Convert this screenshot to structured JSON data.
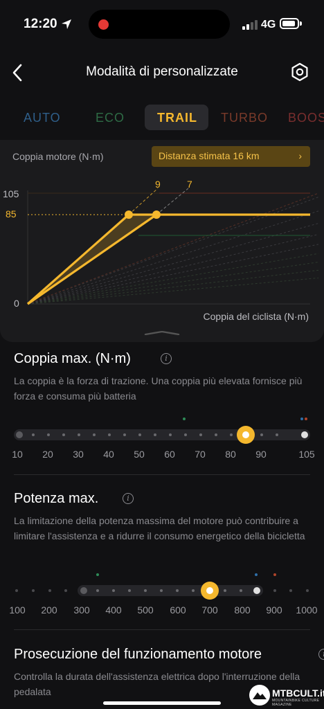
{
  "status_bar": {
    "time": "12:20",
    "network": "4G"
  },
  "header": {
    "title": "Modalità di personalizzate"
  },
  "tabs": [
    {
      "label": "AUTO",
      "color": "#2F5F8A"
    },
    {
      "label": "ECO",
      "color": "#2E6B45"
    },
    {
      "label": "TRAIL",
      "color": "#F5B82E",
      "active": true
    },
    {
      "label": "TURBO",
      "color": "#7A3A2A"
    },
    {
      "label": "BOOS",
      "color": "#7A2E2E"
    }
  ],
  "chart_panel": {
    "torque_label": "Coppia motore (N·m)",
    "distance_button": "Distanza stimata 16 km",
    "chart_data": {
      "type": "line",
      "xlabel": "Coppia del ciclista (N·m)",
      "ylabel": "",
      "y_ticks": [
        "105",
        "85",
        "0"
      ],
      "series": [
        {
          "values": [
            [
              0,
              0
            ],
            [
              9,
              85
            ],
            [
              20,
              85
            ]
          ]
        },
        {
          "values": [
            [
              0,
              0
            ],
            [
              7,
              85
            ],
            [
              20,
              85
            ]
          ]
        }
      ],
      "annotations": [
        "9",
        "7"
      ],
      "max_torque_line": 85,
      "accent_color": "#F5B82E"
    }
  },
  "torque_section": {
    "title": "Coppia max. (N·m)",
    "description": "La coppia è la forza di trazione. Una coppia più elevata fornisce più forza e consuma più batteria",
    "ticks": [
      "10",
      "20",
      "30",
      "40",
      "50",
      "60",
      "70",
      "80",
      "90",
      "105"
    ],
    "value": 85,
    "min": 10,
    "max": 105
  },
  "power_section": {
    "title": "Potenza max.",
    "description": "La limitazione della potenza massima del motore può contribuire a limitare l'assistenza e a ridurre il consumo energetico della bicicletta",
    "ticks": [
      "100",
      "200",
      "300",
      "400",
      "500",
      "600",
      "700",
      "800",
      "900",
      "1000"
    ],
    "value": 700,
    "min": 100,
    "max": 1000
  },
  "overrun_section": {
    "title": "Prosecuzione del funzionamento motore",
    "description": "Controlla la durata dell'assistenza elettrica dopo l'interruzione della pedalata"
  },
  "watermark": {
    "brand": "MTBCULT.it",
    "tagline": "MOUNTAINBIKE CULTURE MAGAZINE"
  }
}
